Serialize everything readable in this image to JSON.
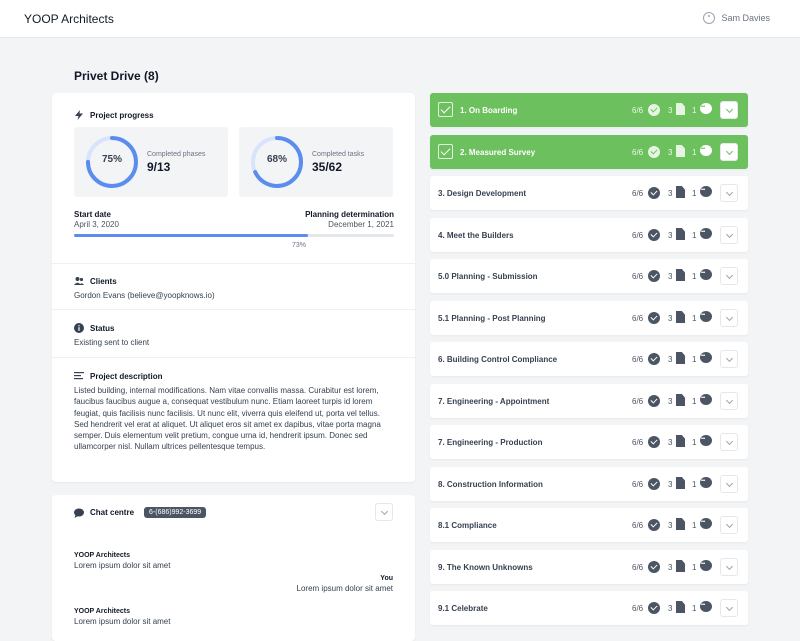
{
  "header": {
    "brand": "YOOP Architects",
    "user_name": "Sam Davies"
  },
  "project": {
    "title": "Privet Drive (8)",
    "progress": {
      "heading": "Project progress",
      "phases": {
        "percent_label": "75%",
        "percent": 75,
        "label": "Completed phases",
        "value": "9/13"
      },
      "tasks": {
        "percent_label": "68%",
        "percent": 68,
        "label": "Completed tasks",
        "value": "35/62"
      }
    },
    "timeline": {
      "start_label": "Start date",
      "start_value": "April 3, 2020",
      "end_label": "Planning determination",
      "end_value": "December 1, 2021",
      "progress_percent": 73,
      "progress_label": "73%"
    },
    "clients": {
      "heading": "Clients",
      "value": "Gordon Evans (believe@yoopknows.io)"
    },
    "status": {
      "heading": "Status",
      "value": "Existing sent to client"
    },
    "description": {
      "heading": "Project description",
      "value": "Listed building, internal modifications. Nam vitae convallis massa. Curabitur est lorem, faucibus faucibus augue a, consequat vestibulum nunc. Etiam laoreet turpis id lorem feugiat, quis facilisis nunc facilisis. Ut nunc elit, viverra quis eleifend ut, porta vel tellus. Sed hendrerit vel erat at aliquet. Ut aliquet eros sit amet ex dapibus, vitae porta magna semper. Duis elementum velit pretium, congue urna id, hendrerit ipsum. Donec sed ullamcorper nisl. Nullam ultrices pellentesque tempus."
    }
  },
  "chat": {
    "heading": "Chat centre",
    "phone": "6-(686)992-3699",
    "messages": [
      {
        "author": "YOOP Architects",
        "text": "Lorem ipsum dolor sit amet",
        "align": "left"
      },
      {
        "author": "You",
        "text": "Lorem ipsum dolor sit amet",
        "align": "right"
      },
      {
        "author": "YOOP Architects",
        "text": "Lorem ipsum dolor sit amet",
        "align": "left"
      }
    ]
  },
  "phases": [
    {
      "name": "1. On Boarding",
      "done": true,
      "tasks": "6/6",
      "docs": "3",
      "comments": "1"
    },
    {
      "name": "2. Measured Survey",
      "done": true,
      "tasks": "6/6",
      "docs": "3",
      "comments": "1"
    },
    {
      "name": "3. Design Development",
      "done": false,
      "tasks": "6/6",
      "docs": "3",
      "comments": "1"
    },
    {
      "name": "4. Meet the Builders",
      "done": false,
      "tasks": "6/6",
      "docs": "3",
      "comments": "1"
    },
    {
      "name": "5.0 Planning - Submission",
      "done": false,
      "tasks": "6/6",
      "docs": "3",
      "comments": "1"
    },
    {
      "name": "5.1 Planning - Post Planning",
      "done": false,
      "tasks": "6/6",
      "docs": "3",
      "comments": "1"
    },
    {
      "name": "6. Building Control Compliance",
      "done": false,
      "tasks": "6/6",
      "docs": "3",
      "comments": "1"
    },
    {
      "name": "7. Engineering - Appointment",
      "done": false,
      "tasks": "6/6",
      "docs": "3",
      "comments": "1"
    },
    {
      "name": "7. Engineering - Production",
      "done": false,
      "tasks": "6/6",
      "docs": "3",
      "comments": "1"
    },
    {
      "name": "8. Construction Information",
      "done": false,
      "tasks": "6/6",
      "docs": "3",
      "comments": "1"
    },
    {
      "name": "8.1 Compliance",
      "done": false,
      "tasks": "6/6",
      "docs": "3",
      "comments": "1"
    },
    {
      "name": "9. The Known Unknowns",
      "done": false,
      "tasks": "6/6",
      "docs": "3",
      "comments": "1"
    },
    {
      "name": "9.1 Celebrate",
      "done": false,
      "tasks": "6/6",
      "docs": "3",
      "comments": "1"
    }
  ],
  "colors": {
    "accent_blue": "#5b8def",
    "done_green": "#6cc05d",
    "badge_gray": "#4b5563"
  }
}
